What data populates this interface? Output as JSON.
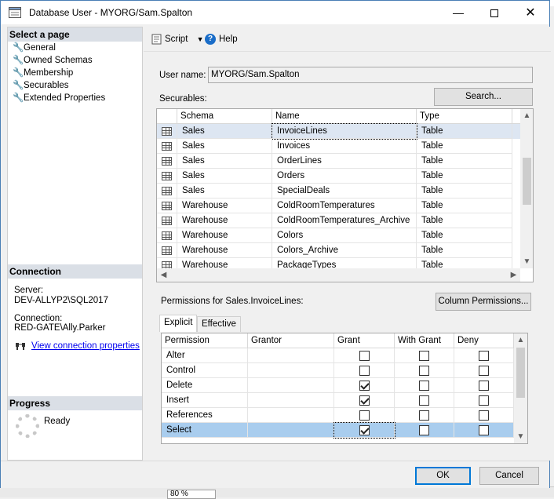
{
  "window": {
    "title": "Database User - MYORG/Sam.Spalton"
  },
  "left": {
    "select_page_header": "Select a page",
    "pages": [
      "General",
      "Owned Schemas",
      "Membership",
      "Securables",
      "Extended Properties"
    ],
    "connection_header": "Connection",
    "server_label": "Server:",
    "server_value": "DEV-ALLYP2\\SQL2017",
    "connection_label": "Connection:",
    "connection_value": "RED-GATE\\Ally.Parker",
    "view_props_link": "View connection properties",
    "progress_header": "Progress",
    "progress_status": "Ready"
  },
  "toolbar": {
    "script_label": "Script",
    "help_label": "Help"
  },
  "form": {
    "user_name_label": "User name:",
    "user_name_value": "MYORG/Sam.Spalton",
    "securables_label": "Securables:",
    "search_button": "Search...",
    "permissions_label": "Permissions for Sales.InvoiceLines:",
    "column_permissions_button": "Column Permissions...",
    "tabs": [
      "Explicit",
      "Effective"
    ]
  },
  "securables": {
    "columns": [
      "Schema",
      "Name",
      "Type"
    ],
    "rows": [
      {
        "schema": "Sales",
        "name": "InvoiceLines",
        "type": "Table"
      },
      {
        "schema": "Sales",
        "name": "Invoices",
        "type": "Table"
      },
      {
        "schema": "Sales",
        "name": "OrderLines",
        "type": "Table"
      },
      {
        "schema": "Sales",
        "name": "Orders",
        "type": "Table"
      },
      {
        "schema": "Sales",
        "name": "SpecialDeals",
        "type": "Table"
      },
      {
        "schema": "Warehouse",
        "name": "ColdRoomTemperatures",
        "type": "Table"
      },
      {
        "schema": "Warehouse",
        "name": "ColdRoomTemperatures_Archive",
        "type": "Table"
      },
      {
        "schema": "Warehouse",
        "name": "Colors",
        "type": "Table"
      },
      {
        "schema": "Warehouse",
        "name": "Colors_Archive",
        "type": "Table"
      },
      {
        "schema": "Warehouse",
        "name": "PackageTypes",
        "type": "Table"
      }
    ]
  },
  "permissions": {
    "columns": [
      "Permission",
      "Grantor",
      "Grant",
      "With Grant",
      "Deny"
    ],
    "rows": [
      {
        "permission": "Alter",
        "grant": false,
        "with_grant": false,
        "deny": false
      },
      {
        "permission": "Control",
        "grant": false,
        "with_grant": false,
        "deny": false
      },
      {
        "permission": "Delete",
        "grant": true,
        "with_grant": false,
        "deny": false
      },
      {
        "permission": "Insert",
        "grant": true,
        "with_grant": false,
        "deny": false
      },
      {
        "permission": "References",
        "grant": false,
        "with_grant": false,
        "deny": false
      },
      {
        "permission": "Select",
        "grant": true,
        "with_grant": false,
        "deny": false
      }
    ]
  },
  "buttons": {
    "ok": "OK",
    "cancel": "Cancel"
  },
  "background": {
    "zoom": "80 %"
  },
  "colors": {
    "selected_row": "#a9cdee",
    "header_band": "#dadfe6",
    "link": "#0000ee"
  }
}
